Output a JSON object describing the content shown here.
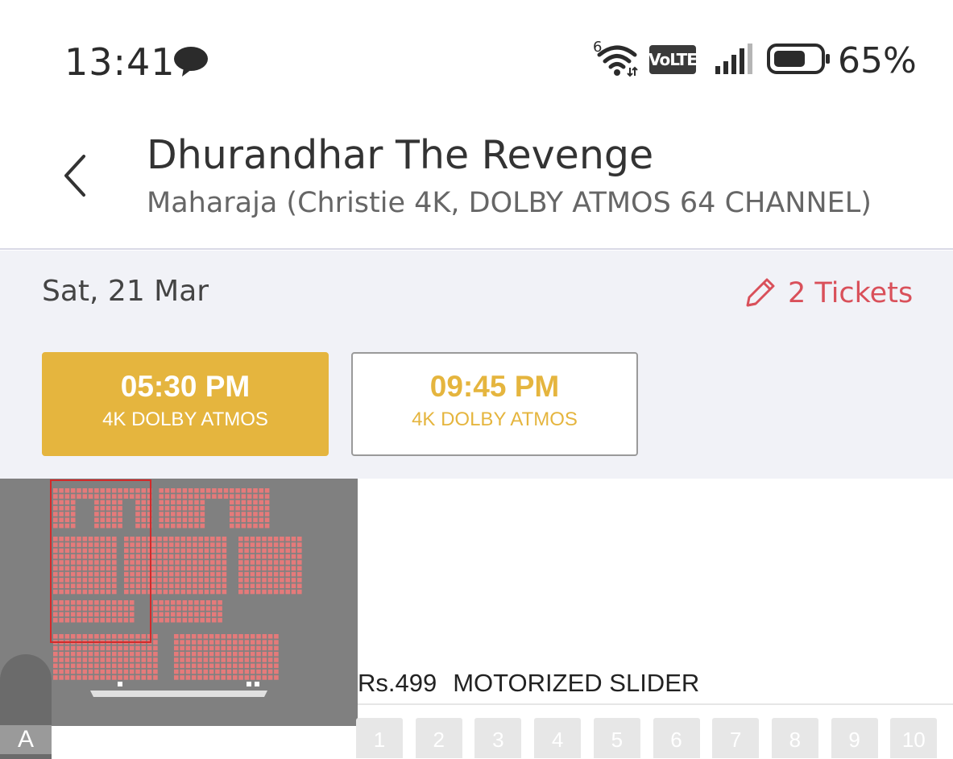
{
  "status_bar": {
    "time": "13:41",
    "battery_pct": "65%",
    "network_badge": "VoLTE",
    "wifi_superscript": "6",
    "icons": [
      "message-bubble-icon",
      "wifi-icon",
      "volte-icon",
      "signal-icon",
      "battery-icon"
    ],
    "battery_level": 0.65
  },
  "header": {
    "title": "Dhurandhar The Revenge",
    "venue": "Maharaja (Christie 4K, DOLBY ATMOS 64 CHANNEL)"
  },
  "date_bar": {
    "date": "Sat, 21 Mar",
    "tickets_label": "2 Tickets"
  },
  "showtimes": [
    {
      "time": "05:30 PM",
      "format": "4K DOLBY ATMOS",
      "selected": true
    },
    {
      "time": "09:45 PM",
      "format": "4K DOLBY ATMOS",
      "selected": false
    }
  ],
  "seat_layout": {
    "price": "Rs.499",
    "category": "MOTORIZED SLIDER",
    "row_label": "A",
    "seats": [
      "1",
      "2",
      "3",
      "4",
      "5",
      "6",
      "7",
      "8",
      "9",
      "10"
    ]
  },
  "colors": {
    "accent": "#e5b53e",
    "ticket_red": "#d9505a",
    "seat_available": "#e57a7a",
    "minimap_bg": "#808080",
    "page_bg": "#f1f2f7"
  }
}
